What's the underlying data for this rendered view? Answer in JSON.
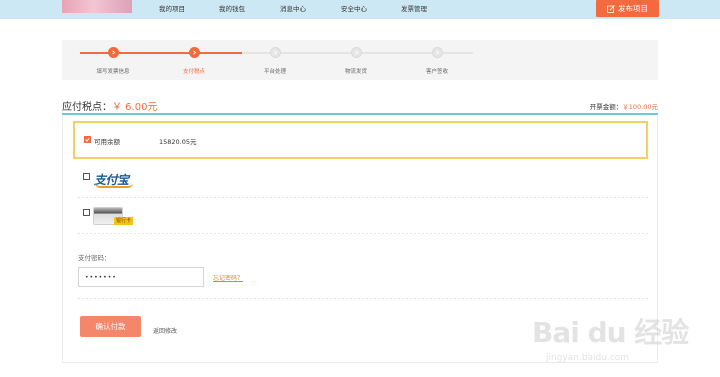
{
  "nav": {
    "items": [
      "我的项目",
      "我的钱包",
      "消息中心",
      "安全中心",
      "发票管理"
    ],
    "publish_label": "发布项目"
  },
  "steps": {
    "items": [
      "填写发票信息",
      "支付税点",
      "平台处理",
      "物流发货",
      "客户签收"
    ],
    "completed": 2,
    "active": 1
  },
  "tax": {
    "label": "应付税点：",
    "amount": "￥ 6.00元",
    "invoice_label": "开票金额：",
    "invoice_amount": "￥100.00元"
  },
  "payment": {
    "balance_label": "可用余额",
    "balance_amount": "15820.05元",
    "balance_checked": true,
    "alipay_logo_text": "支付宝",
    "bankcard_tag": "银行卡",
    "password_label": "支付密码：",
    "password_value": "•••••••",
    "forgot_link": "忘记密码？",
    "confirm_label": "确认付款",
    "back_label": "返回修改"
  },
  "watermark": {
    "logo": "Bai du 经验",
    "url": "jingyan.baidu.com"
  },
  "colors": {
    "accent": "#f26a3d",
    "nav_bg": "#cce8f5",
    "highlight_border": "#f5cf64",
    "rule": "#6cc6e0"
  }
}
